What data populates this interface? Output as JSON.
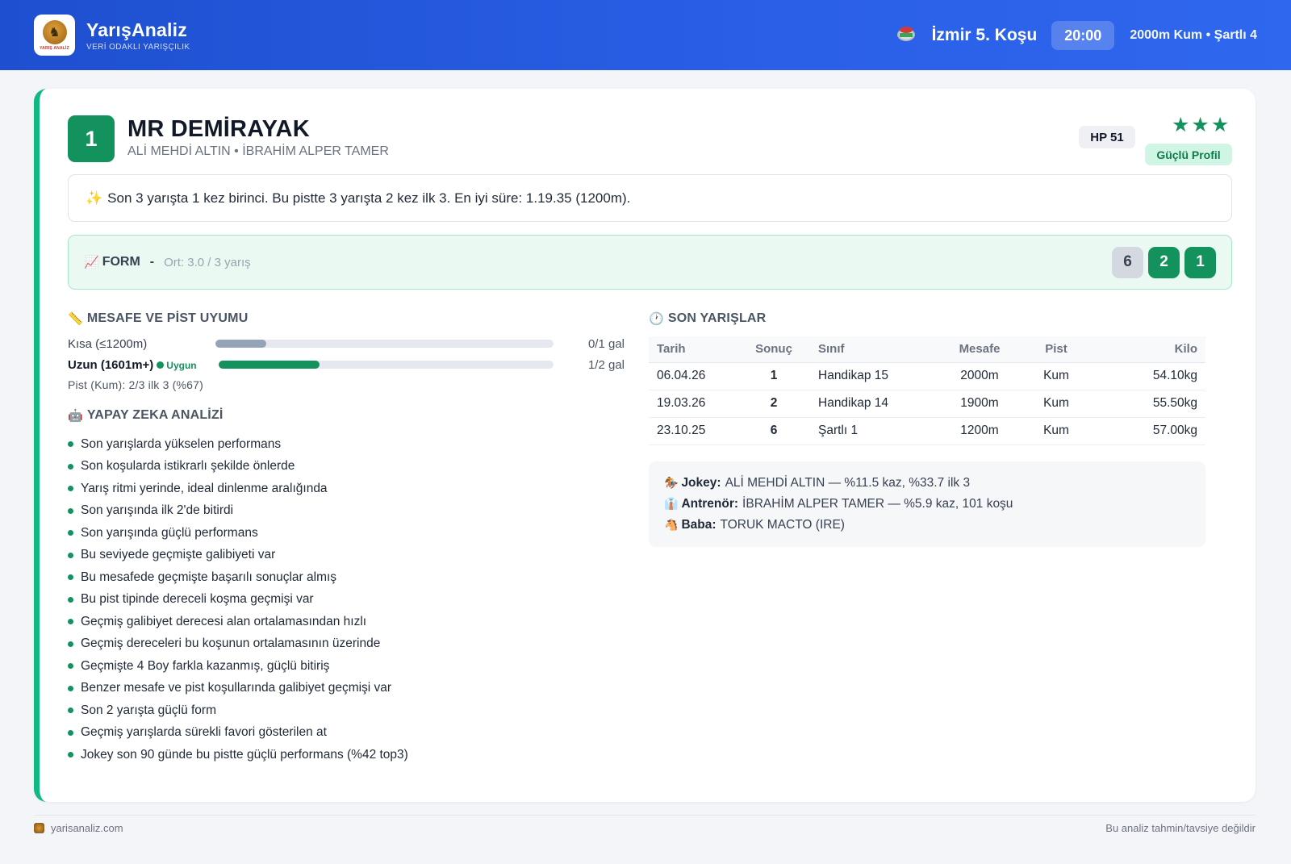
{
  "header": {
    "brand_name": "YarışAnaliz",
    "brand_sub": "VERİ ODAKLI YARIŞÇILIK",
    "logo_text": "YARIŞ ANALİZ",
    "race_title": "İzmir 5. Koşu",
    "time": "20:00",
    "race_info": "2000m Kum • Şartlı 4"
  },
  "horse": {
    "number": "1",
    "name": "MR DEMİRAYAK",
    "jockey_trainer": "ALİ MEHDİ ALTIN • İBRAHİM ALPER TAMER",
    "hp": "HP 51",
    "stars": "★★★",
    "profile": "Güçlü Profil"
  },
  "summary": "Son 3 yarışta 1 kez birinci. Bu pistte 3 yarışta 2 kez ilk 3. En iyi süre: 1.19.35 (1200m).",
  "form": {
    "label": "FORM",
    "sep": "-",
    "avg": "Ort: 3.0 / 3 yarış",
    "results": [
      "6",
      "2",
      "1"
    ]
  },
  "distance": {
    "title": "MESAFE VE PİST UYUMU",
    "rows": [
      {
        "label": "Kısa (≤1200m)",
        "value": "0/1 gal",
        "fill": 0.15
      },
      {
        "label": "Uzun (1601m+)",
        "badge": "Uygun",
        "value": "1/2 gal",
        "fill": 0.3
      }
    ],
    "pist_note": "Pist (Kum): 2/3 ilk 3 (%67)"
  },
  "ai": {
    "title": "YAPAY ZEKA ANALİZİ",
    "items": [
      "Son yarışlarda yükselen performans",
      "Son koşularda istikrarlı şekilde önlerde",
      "Yarış ritmi yerinde, ideal dinlenme aralığında",
      "Son yarışında ilk 2'de bitirdi",
      "Son yarışında güçlü performans",
      "Bu seviyede geçmişte galibiyeti var",
      "Bu mesafede geçmişte başarılı sonuçlar almış",
      "Bu pist tipinde dereceli koşma geçmişi var",
      "Geçmiş galibiyet derecesi alan ortalamasından hızlı",
      "Geçmiş dereceleri bu koşunun ortalamasının üzerinde",
      "Geçmişte 4 Boy farkla kazanmış, güçlü bitiriş",
      "Benzer mesafe ve pist koşullarında galibiyet geçmişi var",
      "Son 2 yarışta güçlü form",
      "Geçmiş yarışlarda sürekli favori gösterilen at",
      "Jokey son 90 günde bu pistte güçlü performans (%42 top3)"
    ]
  },
  "races": {
    "title": "SON YARIŞLAR",
    "columns": [
      "Tarih",
      "Sonuç",
      "Sınıf",
      "Mesafe",
      "Pist",
      "Kilo"
    ],
    "rows": [
      [
        "06.04.26",
        "1",
        "Handikap 15",
        "2000m",
        "Kum",
        "54.10kg"
      ],
      [
        "19.03.26",
        "2",
        "Handikap 14",
        "1900m",
        "Kum",
        "55.50kg"
      ],
      [
        "23.10.25",
        "6",
        "Şartlı 1",
        "1200m",
        "Kum",
        "57.00kg"
      ]
    ]
  },
  "info": {
    "jockey_label": "Jokey:",
    "jockey_text": "ALİ MEHDİ ALTIN — %11.5 kaz, %33.7 ilk 3",
    "trainer_label": "Antrenör:",
    "trainer_text": "İBRAHİM ALPER TAMER — %5.9 kaz, 101 koşu",
    "sire_label": "Baba:",
    "sire_text": "TORUK MACTO (IRE)"
  },
  "footer": {
    "site": "yarisanaliz.com",
    "disclaimer": "Bu analiz tahmin/tavsiye değildir"
  }
}
